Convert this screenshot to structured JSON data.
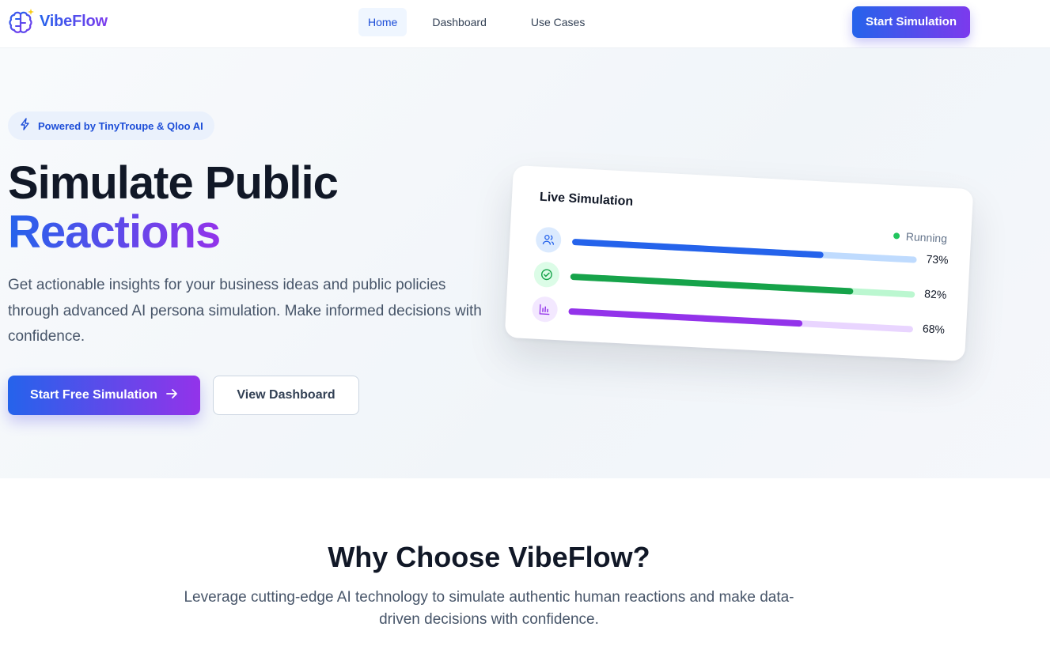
{
  "header": {
    "brand": "VibeFlow",
    "logo_icon": "brain-sparkle-icon",
    "nav": [
      {
        "label": "Home",
        "active": true
      },
      {
        "label": "Dashboard",
        "active": false
      },
      {
        "label": "Use Cases",
        "active": false
      }
    ],
    "cta_label": "Start Simulation"
  },
  "hero": {
    "badge": "Powered by TinyTroupe & Qloo AI",
    "badge_icon": "lightning-icon",
    "title_line1": "Simulate Public",
    "title_line2": "Reactions",
    "lead": "Get actionable insights for your business ideas and public policies through advanced AI persona simulation. Make informed decisions with confidence.",
    "primary_button": "Start Free Simulation",
    "secondary_button": "View Dashboard"
  },
  "card": {
    "title": "Live Simulation",
    "status": "Running",
    "rows": [
      {
        "icon": "users-icon",
        "value": 0.73,
        "label": "73%",
        "color": "#2563eb",
        "track": "#bfdbfe",
        "icon_bg": "#dbeafe"
      },
      {
        "icon": "check-circle-icon",
        "value": 0.82,
        "label": "82%",
        "color": "#16a34a",
        "track": "#bbf7d0",
        "icon_bg": "#dcfce7"
      },
      {
        "icon": "bar-chart-icon",
        "value": 0.68,
        "label": "68%",
        "color": "#9333ea",
        "track": "#e9d5ff",
        "icon_bg": "#f3e8ff"
      }
    ]
  },
  "why": {
    "title": "Why Choose VibeFlow?",
    "subtitle": "Leverage cutting-edge AI technology to simulate authentic human reactions and make data-driven decisions with confidence."
  }
}
